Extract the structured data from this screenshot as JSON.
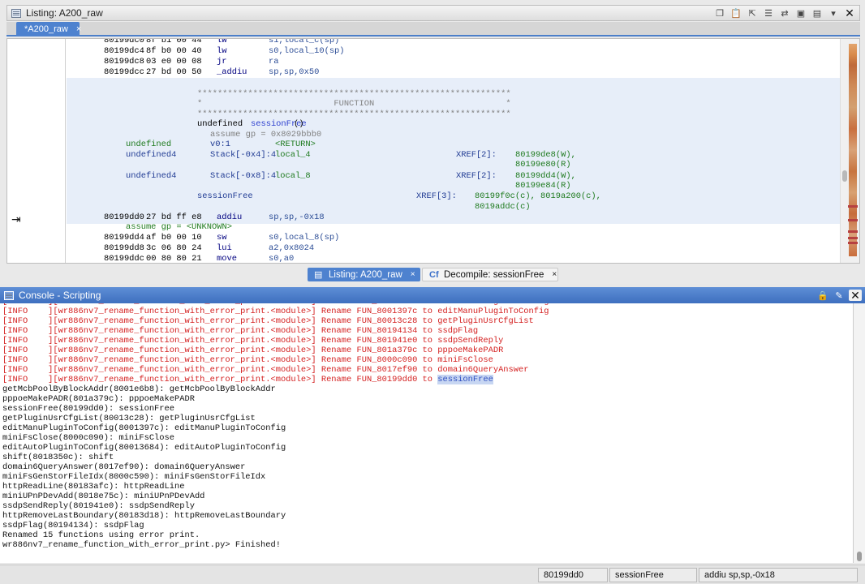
{
  "listing_window": {
    "title": "Listing:  A200_raw",
    "doc_tab_label": "*A200_raw",
    "doc_tab_close": "×"
  },
  "listing": {
    "top_lines": [
      {
        "addr": "80199dc0",
        "bytes": "8f b1 00 44",
        "mnem": "lw",
        "ops": "s1,local_c(sp)"
      },
      {
        "addr": "80199dc4",
        "bytes": "8f b0 00 40",
        "mnem": "lw",
        "ops": "s0,local_10(sp)"
      },
      {
        "addr": "80199dc8",
        "bytes": "03 e0 00 08",
        "mnem": "jr",
        "ops": "ra"
      },
      {
        "addr": "80199dcc",
        "bytes": "27 bd 00 50",
        "mnem": "_addiu",
        "ops": "sp,sp,0x50"
      }
    ],
    "function_banner_stars": "**************************************************************",
    "function_banner_label": "*                          FUNCTION                          *",
    "signature_prefix": "undefined ",
    "signature_name": "sessionFree",
    "signature_suffix": "()",
    "assume_gp": "assume gp = 0x8029bbb0",
    "return_type": "undefined",
    "return_reg": "v0:1",
    "return_tag": "<RETURN>",
    "vars": [
      {
        "type": "undefined4",
        "storage": "Stack[-0x4]:4",
        "name": "local_4",
        "xref": "XREF[2]:",
        "refs": [
          "80199de8(W),",
          "80199e80(R)"
        ]
      },
      {
        "type": "undefined4",
        "storage": "Stack[-0x8]:4",
        "name": "local_8",
        "xref": "XREF[2]:",
        "refs": [
          "80199dd4(W),",
          "80199e84(R)"
        ]
      }
    ],
    "label": "sessionFree",
    "label_xref": "XREF[3]:",
    "label_refs_1": "80199f0c(c), 8019a200(c),",
    "label_refs_2": "8019addc(c)",
    "entry_line": {
      "addr": "80199dd0",
      "bytes": "27 bd ff e8",
      "mnem": "addiu",
      "ops": "sp,sp,-0x18"
    },
    "assume_gp_unknown": "assume gp = <UNKNOWN>",
    "bottom_lines": [
      {
        "addr": "80199dd4",
        "bytes": "af b0 00 10",
        "mnem": "sw",
        "ops": "s0,local_8(sp)"
      },
      {
        "addr": "80199dd8",
        "bytes": "3c 06 80 24",
        "mnem": "lui",
        "ops": "a2,0x8024"
      },
      {
        "addr": "80199ddc",
        "bytes": "00 80 80 21",
        "mnem": "move",
        "ops": "s0,a0"
      }
    ]
  },
  "view_tabs": {
    "listing_label": "Listing:  A200_raw",
    "decompile_icon": "Cf",
    "decompile_label": "Decompile: sessionFree",
    "close": "×"
  },
  "console": {
    "title": "Console - Scripting",
    "info_lines": [
      "[INFO    ][wr886nv7_rename_function_with_error_print.<module>] Rename FUN_8001397c to editManuPluginToConfig",
      "[INFO    ][wr886nv7_rename_function_with_error_print.<module>] Rename FUN_80013c28 to getPluginUsrCfgList",
      "[INFO    ][wr886nv7_rename_function_with_error_print.<module>] Rename FUN_80194134 to ssdpFlag",
      "[INFO    ][wr886nv7_rename_function_with_error_print.<module>] Rename FUN_801941e0 to ssdpSendReply",
      "[INFO    ][wr886nv7_rename_function_with_error_print.<module>] Rename FUN_801a379c to pppoeMakePADR",
      "[INFO    ][wr886nv7_rename_function_with_error_print.<module>] Rename FUN_8000c090 to miniFsClose",
      "[INFO    ][wr886nv7_rename_function_with_error_print.<module>] Rename FUN_8017ef90 to domain6QueryAnswer"
    ],
    "last_info_prefix": "[INFO    ][wr886nv7_rename_function_with_error_print.<module>] Rename FUN_80199dd0 to ",
    "last_info_highlight": "sessionFree",
    "plain_lines": [
      "getMcbPoolByBlockAddr(8001e6b8): getMcbPoolByBlockAddr",
      "pppoeMakePADR(801a379c): pppoeMakePADR",
      "sessionFree(80199dd0): sessionFree",
      "getPluginUsrCfgList(80013c28): getPluginUsrCfgList",
      "editManuPluginToConfig(8001397c): editManuPluginToConfig",
      "miniFsClose(8000c090): miniFsClose",
      "editAutoPluginToConfig(80013684): editAutoPluginToConfig",
      "shift(8018350c): shift",
      "domain6QueryAnswer(8017ef90): domain6QueryAnswer",
      "miniFsGenStorFileIdx(8000c590): miniFsGenStorFileIdx",
      "httpReadLine(80183afc): httpReadLine",
      "miniUPnPDevAdd(8018e75c): miniUPnPDevAdd",
      "ssdpSendReply(801941e0): ssdpSendReply",
      "httpRemoveLastBoundary(80183d18): httpRemoveLastBoundary",
      "ssdpFlag(80194134): ssdpFlag",
      "Renamed 15 functions using error print.",
      "wr886nv7_rename_function_with_error_print.py> Finished!"
    ]
  },
  "status_bar": {
    "address": "80199dd0",
    "function": "sessionFree",
    "instruction": "addiu sp,sp,-0x18"
  }
}
